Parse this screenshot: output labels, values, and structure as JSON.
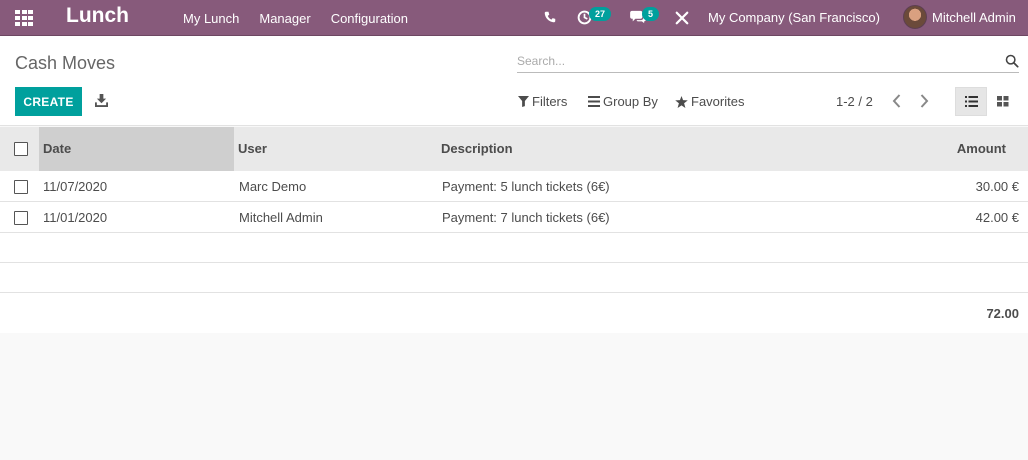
{
  "navbar": {
    "brand": "Lunch",
    "menu": [
      {
        "label": "My Lunch"
      },
      {
        "label": "Manager"
      },
      {
        "label": "Configuration"
      }
    ],
    "activity_count": "27",
    "messages_count": "5",
    "company": "My Company (San Francisco)",
    "user": "Mitchell Admin"
  },
  "control_panel": {
    "breadcrumb": "Cash Moves",
    "search_placeholder": "Search...",
    "create_label": "CREATE",
    "filters_label": "Filters",
    "group_by_label": "Group By",
    "favorites_label": "Favorites",
    "pager": "1-2 / 2"
  },
  "table": {
    "headers": {
      "date": "Date",
      "user": "User",
      "description": "Description",
      "amount": "Amount"
    },
    "rows": [
      {
        "date": "11/07/2020",
        "user": "Marc Demo",
        "description": "Payment: 5 lunch tickets (6€)",
        "amount": "30.00 €"
      },
      {
        "date": "11/01/2020",
        "user": "Mitchell Admin",
        "description": "Payment: 7 lunch tickets (6€)",
        "amount": "42.00 €"
      }
    ],
    "total": "72.00"
  },
  "colors": {
    "navbar": "#875a7b",
    "primary": "#00a09d",
    "header_bg": "#e9e9e9"
  },
  "icons": {
    "apps": "apps-grid-icon",
    "phone": "phone-icon",
    "activity": "clock-icon",
    "messages": "chat-icon",
    "debug": "tools-icon",
    "search": "search-icon",
    "download": "download-icon",
    "filter": "funnel-icon",
    "group": "bars-icon",
    "favorite": "star-icon",
    "list_view": "list-icon",
    "kanban_view": "kanban-icon"
  }
}
